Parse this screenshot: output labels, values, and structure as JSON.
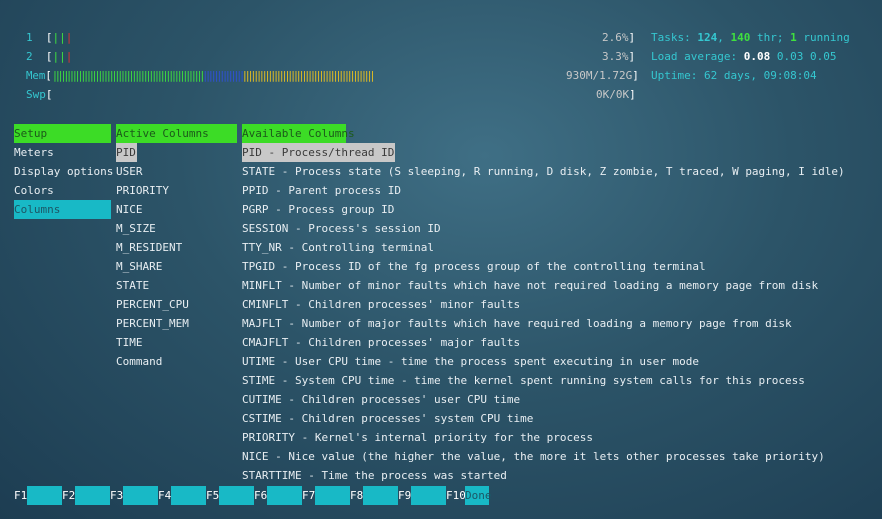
{
  "meters": {
    "cpu1": {
      "label": "1",
      "open": "[",
      "close": "]",
      "bars_green": "||",
      "bars_red": "|",
      "value": "2.6%"
    },
    "cpu2": {
      "label": "2",
      "open": "[",
      "close": "]",
      "bars_green": "||",
      "bars_red": "|",
      "value": "3.3%"
    },
    "mem": {
      "label": "Mem",
      "open": "[",
      "close": "]",
      "bars_green": "|||||||||||||||||||||||||||||||||||||||||||||||||||||",
      "bars_blue": "||||||||||||||",
      "bars_yellow": "||||||||||||||||||||||||||||||||||||||||||||||",
      "value": "930M/1.72G"
    },
    "swp": {
      "label": "Swp",
      "open": "[",
      "close": "]",
      "value": "0K/0K"
    }
  },
  "stats": {
    "tasks_label": "Tasks: ",
    "tasks_count": "124",
    "tasks_sep": ", ",
    "threads": "140",
    "threads_label": " thr; ",
    "running": "1",
    "running_label": " running",
    "load_label": "Load average: ",
    "load1": "0.08",
    "load5": "0.03",
    "load15": "0.05",
    "uptime_label": "Uptime: ",
    "uptime_value": "62 days, 09:08:04"
  },
  "setup": {
    "header": "Setup",
    "items": [
      "Meters",
      "Display options",
      "Colors",
      "Columns"
    ]
  },
  "active_columns": {
    "header": "Active Columns",
    "items": [
      "PID",
      "USER",
      "PRIORITY",
      "NICE",
      "M_SIZE",
      "M_RESIDENT",
      "M_SHARE",
      "STATE",
      "PERCENT_CPU",
      "PERCENT_MEM",
      "TIME",
      "Command"
    ]
  },
  "available_columns": {
    "header": "Available Columns",
    "items": [
      "PID - Process/thread ID",
      "STATE - Process state (S sleeping, R running, D disk, Z zombie, T traced, W paging, I idle)",
      "PPID - Parent process ID",
      "PGRP - Process group ID",
      "SESSION - Process's session ID",
      "TTY_NR - Controlling terminal",
      "TPGID - Process ID of the fg process group of the controlling terminal",
      "MINFLT - Number of minor faults which have not required loading a memory page from disk",
      "CMINFLT - Children processes' minor faults",
      "MAJFLT - Number of major faults which have required loading a memory page from disk",
      "CMAJFLT - Children processes' major faults",
      "UTIME - User CPU time - time the process spent executing in user mode",
      "STIME - System CPU time - time the kernel spent running system calls for this process",
      "CUTIME - Children processes' user CPU time",
      "CSTIME - Children processes' system CPU time",
      "PRIORITY - Kernel's internal priority for the process",
      "NICE - Nice value (the higher the value, the more it lets other processes take priority)",
      "STARTTIME - Time the process was started"
    ]
  },
  "function_keys": [
    {
      "key": "F1",
      "label": ""
    },
    {
      "key": "F2",
      "label": ""
    },
    {
      "key": "F3",
      "label": ""
    },
    {
      "key": "F4",
      "label": ""
    },
    {
      "key": "F5",
      "label": ""
    },
    {
      "key": "F6",
      "label": ""
    },
    {
      "key": "F7",
      "label": ""
    },
    {
      "key": "F8",
      "label": ""
    },
    {
      "key": "F9",
      "label": ""
    },
    {
      "key": "F10",
      "label": "Done"
    }
  ],
  "colors": {
    "cyan": "#35c7d0",
    "green": "#3fe03f",
    "header_green": "#3cdc26",
    "selection_cyan": "#18b9c6",
    "selection_gray": "#c8c8c8"
  }
}
